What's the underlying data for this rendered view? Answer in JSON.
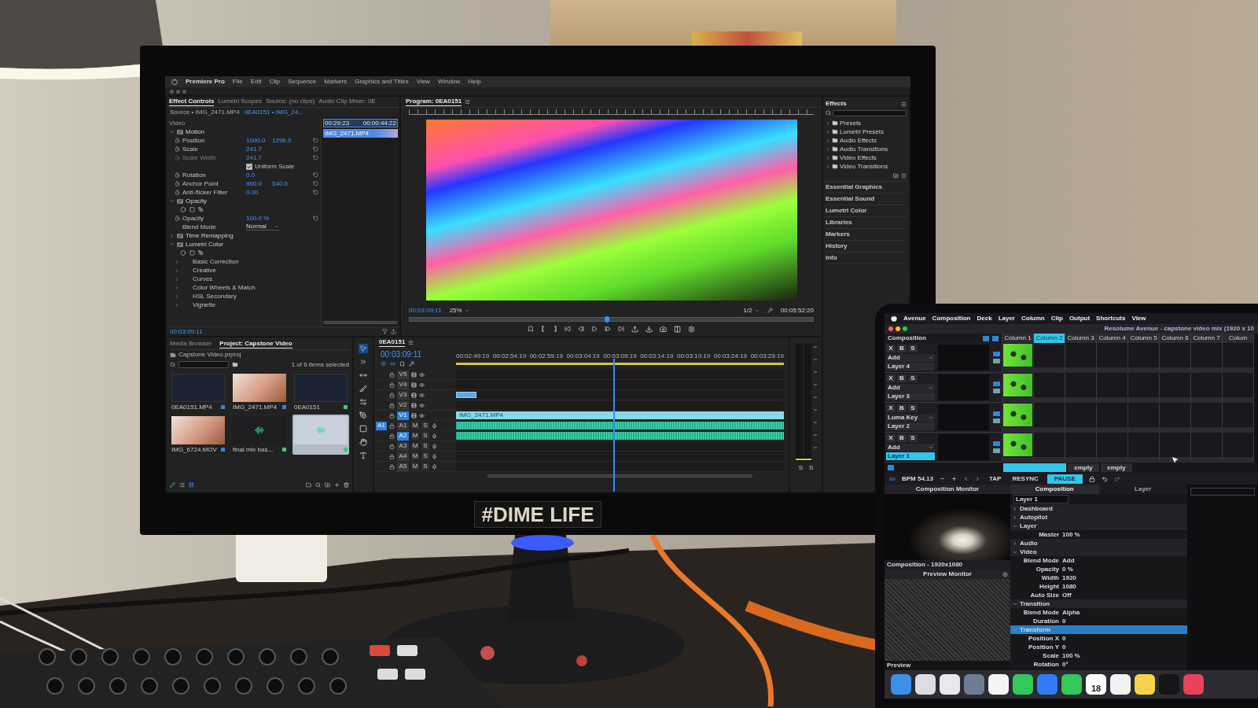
{
  "monitor": {
    "menu_bar": {
      "app": "Premiere Pro",
      "items": [
        "File",
        "Edit",
        "Clip",
        "Sequence",
        "Markers",
        "Graphics and Titles",
        "View",
        "Window",
        "Help"
      ]
    },
    "effect_controls": {
      "tabs": [
        {
          "label": "Effect Controls",
          "selected": true
        },
        {
          "label": "Lumetri Scopes",
          "selected": false
        },
        {
          "label": "Source: (no clips)",
          "selected": false
        },
        {
          "label": "Audio Clip Mixer: 0E",
          "selected": false
        }
      ],
      "source": "Source • IMG_2471.MP4",
      "clip": "0EA0151 • IMG_24...",
      "rows": [
        {
          "kind": "header",
          "label": "Video"
        },
        {
          "kind": "effect",
          "label": "Motion",
          "expanded": true,
          "children": [
            {
              "kind": "property",
              "label": "Position",
              "values": [
                "1000.0",
                "1296.0"
              ],
              "disabled": false
            },
            {
              "kind": "property",
              "label": "Scale",
              "values": [
                "241.7"
              ],
              "disabled": false
            },
            {
              "kind": "property",
              "label": "Scale Width",
              "values": [
                "241.7"
              ],
              "disabled": true
            },
            {
              "kind": "checkbox",
              "label": "Uniform Scale",
              "checked": true
            },
            {
              "kind": "property",
              "label": "Rotation",
              "values": [
                "0.0"
              ],
              "disabled": false
            },
            {
              "kind": "property",
              "label": "Anchor Point",
              "values": [
                "960.0",
                "540.0"
              ],
              "disabled": false
            },
            {
              "kind": "property",
              "label": "Anti-flicker Filter",
              "values": [
                "0.00"
              ],
              "disabled": false
            }
          ]
        },
        {
          "kind": "effect",
          "label": "Opacity",
          "expanded": true,
          "children": [
            {
              "kind": "mask_tools"
            },
            {
              "kind": "property",
              "label": "Opacity",
              "values": [
                "100.0 %"
              ],
              "disabled": false
            },
            {
              "kind": "dropdown",
              "label": "Blend Mode",
              "value": "Normal"
            }
          ]
        },
        {
          "kind": "effect",
          "label": "Time Remapping",
          "expanded": false
        },
        {
          "kind": "effect",
          "label": "Lumetri Color",
          "expanded": true,
          "children": [
            {
              "kind": "mask_tools"
            },
            {
              "kind": "section",
              "label": "Basic Correction"
            },
            {
              "kind": "section",
              "label": "Creative"
            },
            {
              "kind": "section",
              "label": "Curves"
            },
            {
              "kind": "section",
              "label": "Color Wheels & Match"
            },
            {
              "kind": "section",
              "label": "HSL Secondary"
            },
            {
              "kind": "section",
              "label": "Vignette"
            }
          ]
        }
      ],
      "mini_timeline": {
        "start": "00:29:23",
        "end": "00:00:44:22",
        "clip": "IMG_2471.MP4"
      },
      "timecode": "00:03:09:11"
    },
    "program": {
      "title": "Program: 0EA0151",
      "timecode": "00:03:09:11",
      "zoom": "25%",
      "resolution": "1/2",
      "duration": "00:05:52:20",
      "scrubber": {
        "level": 0.49
      }
    },
    "effects": {
      "title": "Effects",
      "folders": [
        "Presets",
        "Lumetri Presets",
        "Audio Effects",
        "Audio Transitions",
        "Video Effects",
        "Video Transitions"
      ],
      "panels": [
        "Essential Graphics",
        "Essential Sound",
        "Lumetri Color",
        "Libraries",
        "Markers",
        "History",
        "Info"
      ]
    },
    "project": {
      "tabs": [
        {
          "label": "Media Browser",
          "selected": false
        },
        {
          "label": "Project: Capstone Video",
          "selected": true
        }
      ],
      "file": "Capstone Video.prproj",
      "selection_count": "1 of 6 items selected",
      "items": [
        {
          "kind": "video",
          "label": "0EA0151.MP4",
          "color": "#3d7fe0",
          "selected": false
        },
        {
          "kind": "photo",
          "label": "IMG_2471.MP4",
          "color": "#3d7fe0",
          "selected": false
        },
        {
          "kind": "video",
          "label": "0EA0151",
          "color": "#4cc27a",
          "selected": false
        },
        {
          "kind": "photo",
          "label": "IMG_6724.MOV",
          "color": "#3d7fe0",
          "selected": false
        },
        {
          "kind": "audio",
          "label": "final mix bas...",
          "color": "#4cc27a",
          "selected": false
        },
        {
          "kind": "audio",
          "color": "#4cc27a",
          "selected": true
        }
      ]
    },
    "tools": [
      {
        "kind": "selection",
        "selected": true
      },
      {
        "kind": "track_select",
        "selected": false
      },
      {
        "kind": "ripple",
        "selected": false
      },
      {
        "kind": "razor",
        "selected": false
      },
      {
        "kind": "slip",
        "selected": false
      },
      {
        "kind": "pen",
        "selected": false
      },
      {
        "kind": "rectangle",
        "selected": false
      },
      {
        "kind": "hand",
        "selected": false
      },
      {
        "kind": "type",
        "selected": false
      }
    ],
    "timeline": {
      "title": "0EA0151",
      "timecode": "00:03:09:11",
      "ruler": [
        "00:02:49:19",
        "00:02:54:19",
        "00:02:59:19",
        "00:03:04:19",
        "00:03:09:19",
        "00:03:14:19",
        "00:03:19:19",
        "00:03:24:19",
        "00:03:29:19"
      ],
      "playhead": {
        "level": 0.48
      },
      "tracks": [
        {
          "label": "V5",
          "kind": "video",
          "targeted": false
        },
        {
          "label": "V4",
          "kind": "video",
          "targeted": false
        },
        {
          "label": "V3",
          "kind": "video",
          "targeted": false,
          "clip": {
            "kind": "video_short"
          }
        },
        {
          "label": "V2",
          "kind": "video",
          "targeted": false
        },
        {
          "label": "V1",
          "kind": "video",
          "targeted": true,
          "clip": {
            "kind": "video",
            "label": "IMG_2471.MP4"
          }
        },
        {
          "label": "A1",
          "kind": "audio",
          "targeted": false,
          "source_patch": "A1",
          "buttons": [
            "M",
            "S"
          ],
          "clip": {
            "kind": "audio"
          }
        },
        {
          "label": "A2",
          "kind": "audio",
          "targeted": true,
          "buttons": [
            "M",
            "S"
          ],
          "clip": {
            "kind": "audio"
          }
        },
        {
          "label": "A3",
          "kind": "audio",
          "targeted": false,
          "buttons": [
            "M",
            "S"
          ]
        },
        {
          "label": "A4",
          "kind": "audio",
          "targeted": false,
          "buttons": [
            "M",
            "S"
          ]
        },
        {
          "label": "A5",
          "kind": "audio",
          "targeted": false,
          "buttons": [
            "M",
            "S"
          ]
        }
      ]
    },
    "meter": {
      "buttons": [
        "S",
        "S"
      ]
    },
    "sticker": "#DIME LIFE"
  },
  "laptop": {
    "menu_bar": {
      "items": [
        "Avenue",
        "Composition",
        "Deck",
        "Layer",
        "Column",
        "Clip",
        "Output",
        "Shortcuts",
        "View"
      ]
    },
    "title": "Resolume Avenue - capstone video mix (1920 x 10",
    "composition_label": "Composition",
    "columns": [
      {
        "label": "Column 1",
        "selected": false
      },
      {
        "label": "Column 2",
        "selected": true
      },
      {
        "label": "Column 3",
        "selected": false
      },
      {
        "label": "Column 4",
        "selected": false
      },
      {
        "label": "Column 5",
        "selected": false
      },
      {
        "label": "Column 6",
        "selected": false
      },
      {
        "label": "Column 7",
        "selected": false
      },
      {
        "label": "Colum",
        "selected": false
      }
    ],
    "layers": [
      {
        "name": "Layer 4",
        "blend": "Add",
        "buttons": [
          "X",
          "B",
          "S"
        ],
        "has_clip": true,
        "selected": false
      },
      {
        "name": "Layer 3",
        "blend": "Add",
        "buttons": [
          "X",
          "B",
          "S"
        ],
        "has_clip": true,
        "selected": false
      },
      {
        "name": "Layer 2",
        "blend": "Luma Key",
        "buttons": [
          "X",
          "B",
          "S"
        ],
        "has_clip": true,
        "selected": false
      },
      {
        "name": "Layer 1",
        "blend": "Add",
        "buttons": [
          "X",
          "B",
          "S"
        ],
        "has_clip": true,
        "selected": true
      }
    ],
    "decks": [
      {
        "selected": true
      },
      {
        "label": "empty",
        "selected": false
      },
      {
        "label": "empty",
        "selected": false
      }
    ],
    "bpm": "BPM 54.13",
    "transport": [
      {
        "label": "TAP",
        "selected": false
      },
      {
        "label": "RESYNC",
        "selected": false
      },
      {
        "label": "PAUSE",
        "selected": true
      }
    ],
    "composition_monitor": {
      "title": "Composition Monitor",
      "caption": "Composition - 1920x1080"
    },
    "preview_monitor": {
      "title": "Preview Monitor",
      "caption": "Preview"
    },
    "inspector": {
      "tabs": [
        {
          "label": "Composition",
          "selected": true
        },
        {
          "label": "Layer",
          "selected": false
        }
      ],
      "layer_field": "Layer 1",
      "rows": [
        {
          "kind": "group",
          "label": "Dashboard",
          "expanded": false,
          "selected": false
        },
        {
          "kind": "group",
          "label": "Autopilot",
          "expanded": false,
          "selected": false
        },
        {
          "kind": "group",
          "label": "Layer",
          "expanded": true,
          "selected": false
        },
        {
          "kind": "param",
          "label": "Master",
          "value": "100 %",
          "selected": false
        },
        {
          "kind": "group",
          "label": "Audio",
          "expanded": false,
          "selected": false
        },
        {
          "kind": "group",
          "label": "Video",
          "expanded": true,
          "selected": false
        },
        {
          "kind": "param",
          "label": "Blend Mode",
          "value": "Add",
          "selected": false
        },
        {
          "kind": "param",
          "label": "Opacity",
          "value": "0 %",
          "selected": false
        },
        {
          "kind": "param",
          "label": "Width",
          "value": "1920",
          "selected": false
        },
        {
          "kind": "param",
          "label": "Height",
          "value": "1080",
          "selected": false
        },
        {
          "kind": "param",
          "label": "Auto Size",
          "value": "Off",
          "selected": false
        },
        {
          "kind": "group",
          "label": "Transition",
          "expanded": true,
          "selected": false
        },
        {
          "kind": "param",
          "label": "Blend Mode",
          "value": "Alpha",
          "selected": false
        },
        {
          "kind": "param",
          "label": "Duration",
          "value": "0",
          "selected": false
        },
        {
          "kind": "group",
          "label": "Transform",
          "expanded": true,
          "selected": true
        },
        {
          "kind": "param",
          "label": "Position X",
          "value": "0",
          "selected": false
        },
        {
          "kind": "param",
          "label": "Position Y",
          "value": "0",
          "selected": false
        },
        {
          "kind": "param",
          "label": "Scale",
          "value": "100 %",
          "selected": false
        },
        {
          "kind": "param",
          "label": "Rotation",
          "value": "0°",
          "selected": false
        }
      ]
    },
    "dock": {
      "calendar_day": "18"
    }
  }
}
